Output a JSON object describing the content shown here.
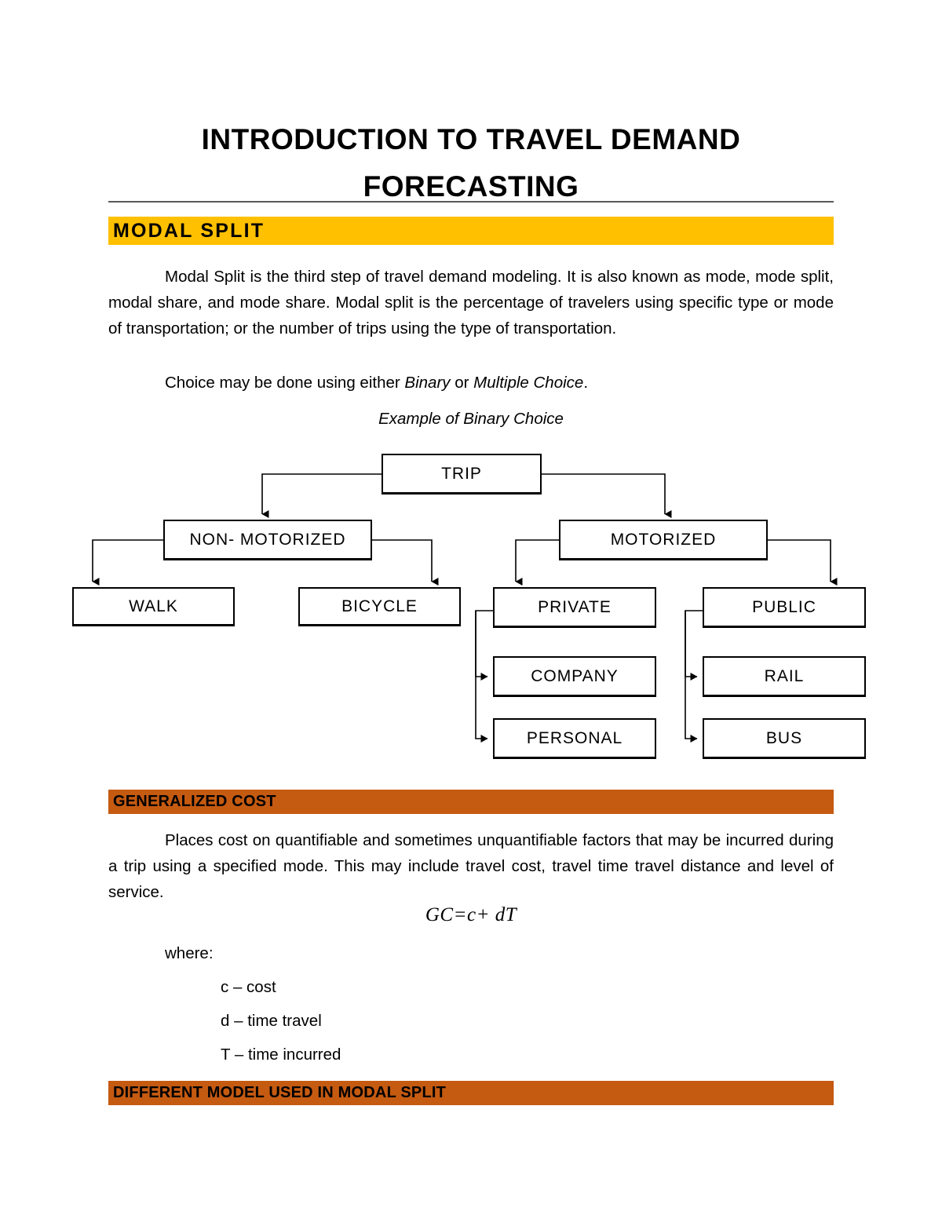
{
  "document": {
    "title": "INTRODUCTION TO TRAVEL DEMAND FORECASTING"
  },
  "sections": {
    "modal_split": {
      "heading": "MODAL SPLIT",
      "heading_color": "#FFC000",
      "paragraph_indent": "",
      "paragraph": "Modal Split is the third step of travel demand modeling. It is also known as mode, mode split, modal share, and mode share. Modal split is the percentage of travelers using specific type or mode of transportation; or the number of trips using the type of transportation.",
      "choice_line_prefix": "Choice may be done using either ",
      "choice_line_italic_1": "Binary",
      "choice_line_middle": " or ",
      "choice_line_italic_2": "Multiple Choice",
      "choice_line_suffix": ".",
      "example_caption": "Example of Binary Choice"
    },
    "generalized_cost": {
      "heading": "GENERALIZED COST",
      "heading_color": "#C55A11",
      "paragraph": "Places cost on quantifiable and sometimes unquantifiable factors that may be incurred during a trip using a specified mode. This may include travel cost, travel time travel distance and level of service.",
      "formula": "GC=c+ dT",
      "where_label": "where:",
      "where_items": [
        "c – cost",
        "d – time travel",
        "T – time incurred"
      ]
    },
    "different_model": {
      "heading": "DIFFERENT MODEL USED IN MODAL SPLIT",
      "heading_color": "#C55A11"
    }
  },
  "flowchart": {
    "nodes": {
      "trip": "TRIP",
      "non_motorized": "NON- MOTORIZED",
      "motorized": "MOTORIZED",
      "walk": "WALK",
      "bicycle": "BICYCLE",
      "private": "PRIVATE",
      "public": "PUBLIC",
      "company": "COMPANY",
      "rail": "RAIL",
      "personal": "PERSONAL",
      "bus": "BUS"
    }
  }
}
